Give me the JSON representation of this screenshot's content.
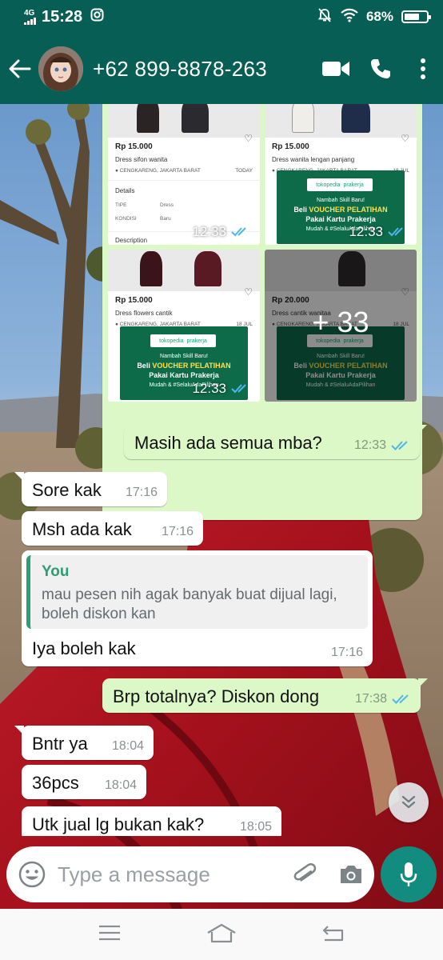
{
  "status_bar": {
    "network": "4G",
    "time": "15:28",
    "battery": "68%",
    "battery_level": 0.68
  },
  "header": {
    "contact": "+62 899-8878-263",
    "icons": [
      "back-arrow-icon",
      "video-call-icon",
      "phone-icon",
      "more-vert-icon"
    ]
  },
  "album": {
    "products": [
      {
        "price": "Rp 15.000",
        "title": "Dress sifon wanita",
        "location": "CENGKARENG, JAKARTA BARAT",
        "date": "TODAY",
        "details_label": "Details",
        "tipe_label": "TIPE",
        "tipe_value": "Dress",
        "kondisi_label": "KONDISI",
        "kondisi_value": "Baru",
        "description_label": "Description",
        "time": "12:33"
      },
      {
        "price": "Rp 15.000",
        "title": "Dress wanita lengan panjang",
        "location": "CENGKARENG, JAKARTA BARAT",
        "date": "18 JUL",
        "time": "12:33"
      },
      {
        "price": "Rp 15.000",
        "title": "Dress flowers cantik",
        "location": "CENGKARENG, JAKARTA BARAT",
        "date": "18 JUL",
        "time": "12:33"
      },
      {
        "price": "Rp 20.000",
        "title": "Dress cantik wanitaa",
        "location": "CENGKARENG, JAKARTA BARAT",
        "date": "18 JUL",
        "more_count": "+ 33"
      }
    ],
    "ad": {
      "logo_left": "tokopedia",
      "logo_right": "prakerja",
      "line1": "Nambah Skill Baru!",
      "line2_prefix": "Beli ",
      "line2_highlight": "VOUCHER PELATIHAN",
      "line3": "Pakai Kartu Prakerja",
      "line4": "Mudah & #SelaluAdaPilihan"
    }
  },
  "messages": [
    {
      "dir": "out",
      "text": "Masih ada semua mba?",
      "time": "12:33",
      "ticks": "read"
    },
    {
      "dir": "in",
      "text": "Sore kak",
      "time": "17:16"
    },
    {
      "dir": "in",
      "text": "Msh ada kak",
      "time": "17:16"
    },
    {
      "dir": "in",
      "quote_author": "You",
      "quote_text": "mau pesen nih agak banyak buat dijual lagi, boleh diskon kan",
      "text": "Iya boleh kak",
      "time": "17:16"
    },
    {
      "dir": "out",
      "text": "Brp totalnya? Diskon dong",
      "time": "17:38",
      "ticks": "read"
    },
    {
      "dir": "in",
      "text": "Bntr ya",
      "time": "18:04"
    },
    {
      "dir": "in",
      "text": "36pcs",
      "time": "18:04"
    },
    {
      "dir": "in",
      "text": "Utk jual lg bukan kak?",
      "time": "18:05"
    }
  ],
  "composer": {
    "placeholder": "Type a message",
    "icons": [
      "emoji-icon",
      "attach-icon",
      "camera-icon",
      "mic-icon"
    ]
  },
  "colors": {
    "header": "#075e54",
    "outgoing": "#dcf8c6",
    "incoming": "#ffffff",
    "read_ticks": "#4fb6ec",
    "fab": "#128c7e"
  }
}
